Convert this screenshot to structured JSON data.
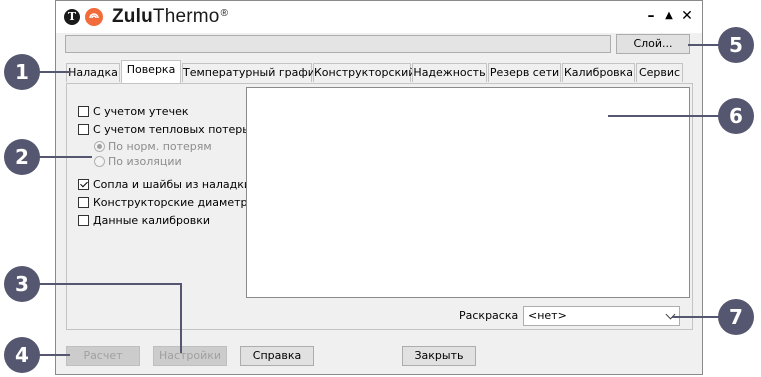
{
  "window": {
    "title_bold": "Zulu",
    "title_rest": "Thermo",
    "title_mark": "®",
    "logo_letter": "T",
    "controls": {
      "minimize": "–",
      "maximize": "▲",
      "close": "✕"
    }
  },
  "layer_button": "Слой...",
  "tabs": [
    {
      "label": "Наладка",
      "active": false
    },
    {
      "label": "Поверка",
      "active": true
    },
    {
      "label": "Температурный график",
      "active": false
    },
    {
      "label": "Конструкторский",
      "active": false
    },
    {
      "label": "Надежность",
      "active": false
    },
    {
      "label": "Резерв сети",
      "active": false
    },
    {
      "label": "Калибровка",
      "active": false
    },
    {
      "label": "Сервис",
      "active": false
    }
  ],
  "options": {
    "leaks": {
      "label": "С учетом утечек",
      "checked": false
    },
    "heat_loss": {
      "label": "С учетом тепловых потерь",
      "checked": false
    },
    "by_norm": {
      "label": "По норм. потерям",
      "checked": true,
      "enabled": false
    },
    "by_insulation": {
      "label": "По изоляции",
      "checked": false,
      "enabled": false
    },
    "nozzles": {
      "label": "Сопла и шайбы из наладки",
      "checked": true
    },
    "design_diam": {
      "label": "Конструкторские диаметры",
      "checked": false
    },
    "calib_data": {
      "label": "Данные калибровки",
      "checked": false
    }
  },
  "coloring": {
    "label": "Раскраска",
    "value": "<нет>"
  },
  "buttons": {
    "calc": "Расчет",
    "settings": "Настройки",
    "help": "Справка",
    "close": "Закрыть"
  },
  "callouts": [
    "1",
    "2",
    "3",
    "4",
    "5",
    "6",
    "7"
  ],
  "colors": {
    "callout": "#55566f",
    "accent_logo": "#f26b3a"
  }
}
